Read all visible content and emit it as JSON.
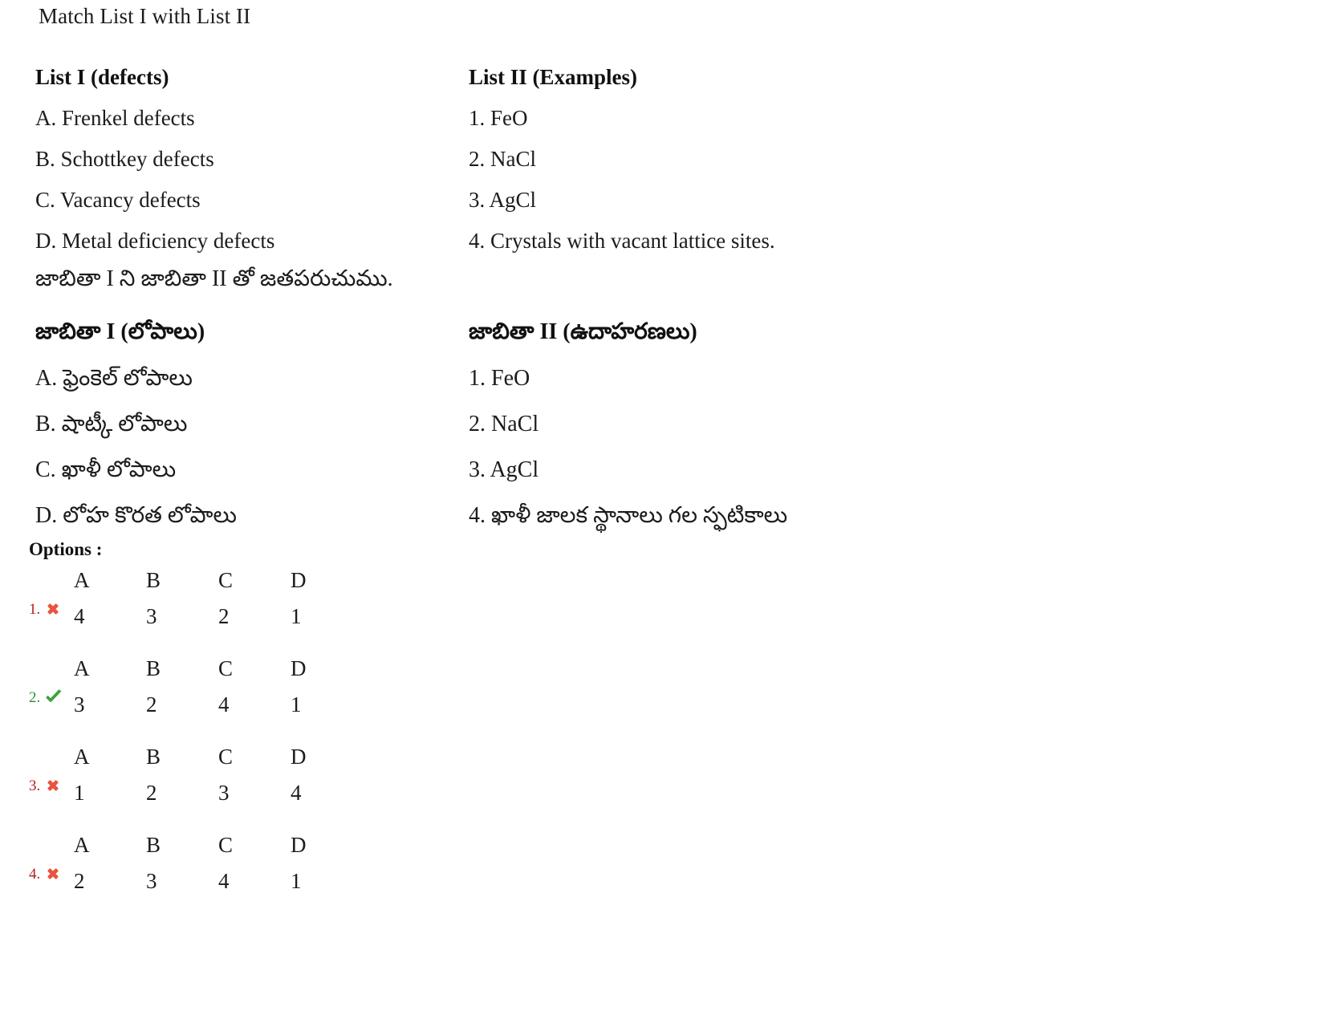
{
  "question": {
    "stem_en": "Match List I with List II",
    "stem_te": "జాబితా I ని జాబితా II తో జతపరుచుము."
  },
  "english": {
    "list1_header": "List I (defects)",
    "list2_header": "List II (Examples)",
    "list1_items": [
      "A. Frenkel defects",
      "B. Schottkey defects",
      "C. Vacancy defects",
      "D. Metal deficiency defects"
    ],
    "list2_items": [
      "1. FeO",
      "2. NaCl",
      "3. AgCl",
      "4. Crystals with vacant lattice sites."
    ]
  },
  "telugu": {
    "list1_header": "జాబితా I (లోపాలు)",
    "list2_header": "జాబితా II (ఉదాహరణలు)",
    "list1_items": [
      "A. ఫ్రెంకెల్ లోపాలు",
      "B. షాట్కీ లోపాలు",
      "C. ఖాళీ లోపాలు",
      "D. లోహ కొరత లోపాలు"
    ],
    "list2_items": [
      "1. FeO",
      "2. NaCl",
      "3. AgCl",
      "4. ఖాళీ జాలక స్థానాలు గల స్ఫటికాలు"
    ]
  },
  "options_section": {
    "label": "Options :",
    "column_headers": [
      "A",
      "B",
      "C",
      "D"
    ],
    "options": [
      {
        "number": "1.",
        "status": "wrong",
        "icon": "cross-icon",
        "values": [
          "4",
          "3",
          "2",
          "1"
        ]
      },
      {
        "number": "2.",
        "status": "correct",
        "icon": "check-icon",
        "values": [
          "3",
          "2",
          "4",
          "1"
        ]
      },
      {
        "number": "3.",
        "status": "wrong",
        "icon": "cross-icon",
        "values": [
          "1",
          "2",
          "3",
          "4"
        ]
      },
      {
        "number": "4.",
        "status": "wrong",
        "icon": "cross-icon",
        "values": [
          "2",
          "3",
          "4",
          "1"
        ]
      }
    ]
  },
  "colors": {
    "wrong": "#e8543f",
    "wrong_text": "#b22222",
    "correct": "#3ba33b",
    "correct_text": "#2e8b2e",
    "text": "#1c1c1c",
    "background": "#ffffff"
  }
}
